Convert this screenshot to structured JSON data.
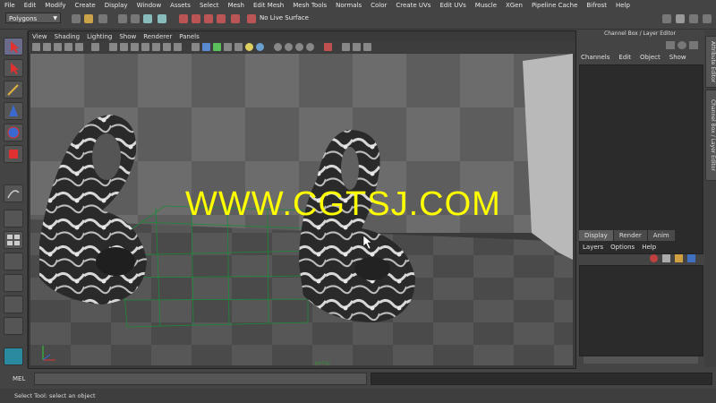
{
  "menubar": [
    "File",
    "Edit",
    "Modify",
    "Create",
    "Display",
    "Window",
    "Assets",
    "Select",
    "Mesh",
    "Edit Mesh",
    "Mesh Tools",
    "Normals",
    "Color",
    "Create UVs",
    "Edit UVs",
    "Muscle",
    "XGen",
    "Pipeline Cache",
    "Bifrost",
    "Help"
  ],
  "statusline": {
    "mode": "Polygons",
    "live_surface": "No Live Surface"
  },
  "viewport": {
    "menu": [
      "View",
      "Shading",
      "Lighting",
      "Show",
      "Renderer",
      "Panels"
    ],
    "camera_label": "persp",
    "watermark": "WWW.CGTSJ.COM"
  },
  "channel_box": {
    "title": "Channel Box / Layer Editor",
    "menu": [
      "Channels",
      "Edit",
      "Object",
      "Show"
    ]
  },
  "layer_editor": {
    "tabs": [
      "Display",
      "Render",
      "Anim"
    ],
    "menu": [
      "Layers",
      "Options",
      "Help"
    ]
  },
  "side_tabs": [
    "Attribute Editor",
    "Channel Box / Layer Editor"
  ],
  "command_line": {
    "label": "MEL"
  },
  "help_line": {
    "text": "Select Tool: select an object"
  }
}
